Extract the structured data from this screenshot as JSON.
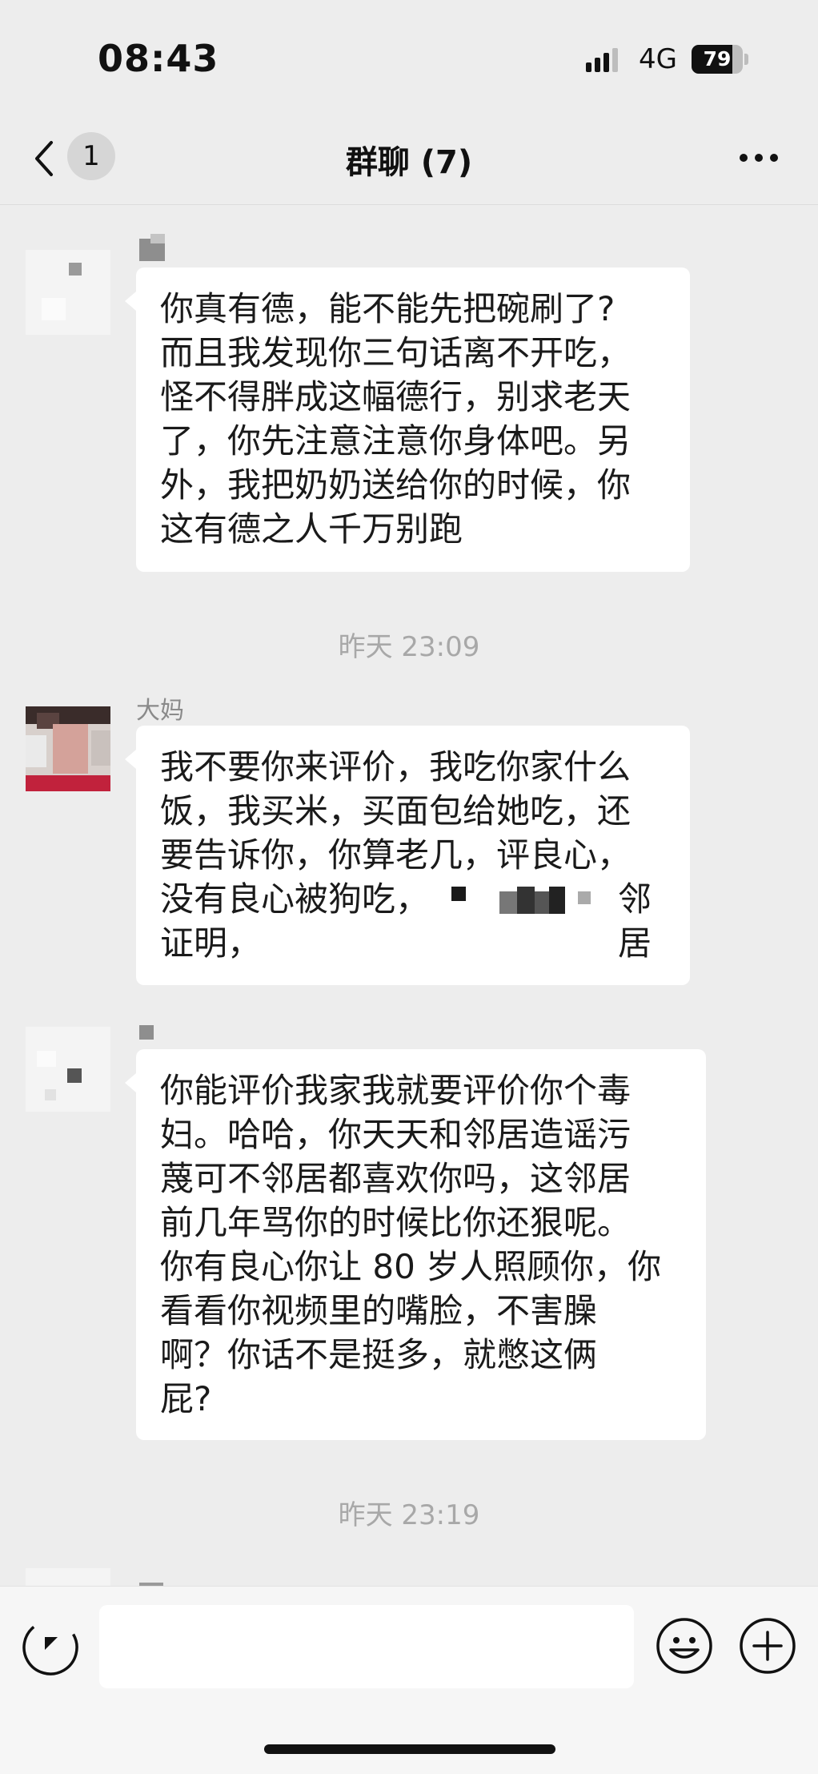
{
  "status": {
    "time": "08:43",
    "network": "4G",
    "battery_level": "79",
    "battery_fraction": 0.79
  },
  "nav": {
    "unread_count": "1",
    "title": "群聊 (7)"
  },
  "messages": [
    {
      "sender": "",
      "text_lines": [
        "你真有德，能不能先把碗刷了?",
        "而且我发现你三句话离不开吃，",
        "怪不得胖成这幅德行，别求老天",
        "了，你先注意注意你身体吧。另",
        "外，我把奶奶送给你的时候，你",
        "这有德之人千万别跑"
      ]
    },
    {
      "timestamp": "昨天 23:09"
    },
    {
      "sender": "大妈",
      "text_lines": [
        "我不要你来评价，我吃你家什么",
        "饭，我买米，买面包给她吃，还",
        "要告诉你，你算老几，评良心，",
        "没有良心被狗吃，",
        "证明，"
      ],
      "line4_tail": "邻居"
    },
    {
      "sender": "",
      "text_lines": [
        "你能评价我家我就要评价你个毒",
        "妇。哈哈，你天天和邻居造谣污",
        "蔑可不邻居都喜欢你吗，这邻居",
        "前几年骂你的时候比你还狠呢。",
        "你有良心你让 80 岁人照顾你，你",
        "看看你视频里的嘴脸，不害臊",
        "啊？你话不是挺多，就憋这俩",
        "屁?"
      ]
    },
    {
      "timestamp": "昨天 23:19"
    }
  ],
  "input": {
    "placeholder": ""
  },
  "colors": {
    "background": "#ededed",
    "bubble": "#ffffff",
    "timestamp": "#a8a8a8"
  }
}
